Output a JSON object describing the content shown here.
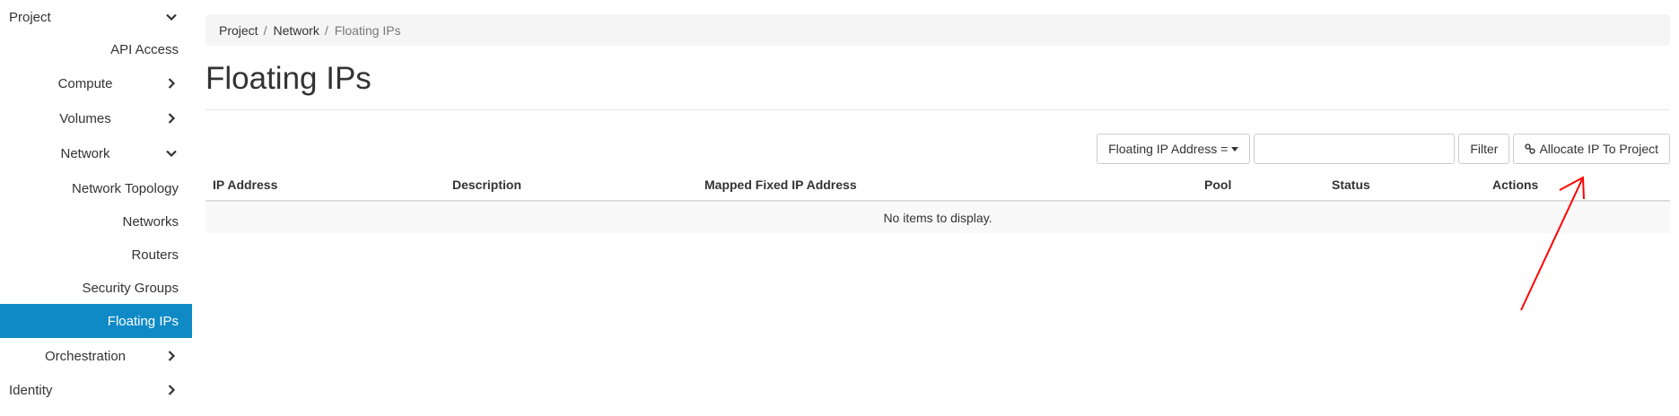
{
  "sidebar": {
    "project_label": "Project",
    "items": [
      {
        "label": "API Access"
      },
      {
        "label": "Compute"
      },
      {
        "label": "Volumes"
      },
      {
        "label": "Network"
      },
      {
        "label": "Network Topology"
      },
      {
        "label": "Networks"
      },
      {
        "label": "Routers"
      },
      {
        "label": "Security Groups"
      },
      {
        "label": "Floating IPs"
      },
      {
        "label": "Orchestration"
      }
    ],
    "identity_label": "Identity",
    "active_color": "#0f8ac7"
  },
  "breadcrumb": {
    "items": [
      "Project",
      "Network"
    ],
    "separator": "/",
    "current": "Floating IPs"
  },
  "page": {
    "title": "Floating IPs"
  },
  "toolbar": {
    "filter_select_label": "Floating IP Address =",
    "filter_input_value": "",
    "filter_button_label": "Filter",
    "allocate_button_label": "Allocate IP To Project",
    "allocate_icon": "link-icon"
  },
  "table": {
    "columns": [
      "IP Address",
      "Description",
      "Mapped Fixed IP Address",
      "Pool",
      "Status",
      "Actions"
    ],
    "empty_message": "No items to display."
  },
  "annotation": {
    "arrow_color": "#ff0000"
  }
}
